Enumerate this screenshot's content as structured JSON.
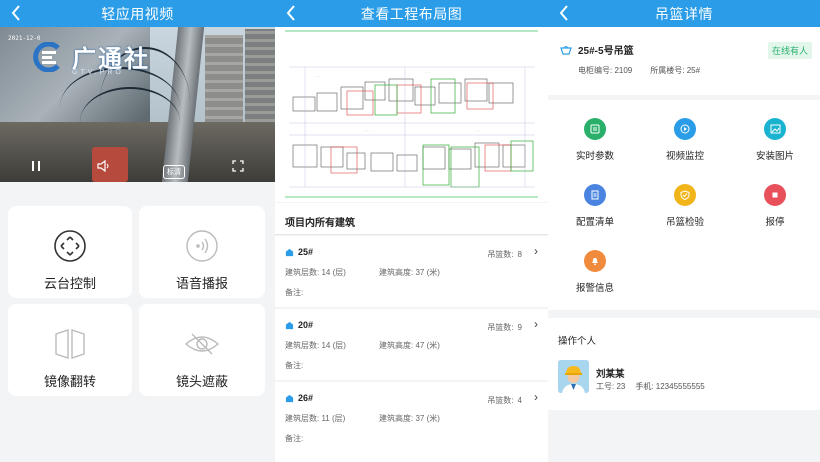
{
  "panel1": {
    "nav_title": "轻应用视频",
    "video": {
      "timestamp": "2021-12-0",
      "watermark_text": "广通社",
      "watermark_sub": "GTV.PRO",
      "quality": "标清"
    },
    "cards": [
      {
        "label": "云台控制",
        "icon": "ptz-icon"
      },
      {
        "label": "语音播报",
        "icon": "broadcast-icon"
      },
      {
        "label": "镜像翻转",
        "icon": "mirror-icon"
      },
      {
        "label": "镜头遮蔽",
        "icon": "eye-off-icon"
      }
    ]
  },
  "panel2": {
    "nav_title": "查看工程布局图",
    "section_title": "项目内所有建筑",
    "buildings": [
      {
        "name": "25#",
        "basket_label": "吊篮数:",
        "basket_count": "8",
        "floors": "建筑层数: 14 (层)",
        "height": "建筑高度: 37 (米)",
        "note": "备注:"
      },
      {
        "name": "20#",
        "basket_label": "吊篮数:",
        "basket_count": "9",
        "floors": "建筑层数: 14 (层)",
        "height": "建筑高度: 47 (米)",
        "note": "备注:"
      },
      {
        "name": "26#",
        "basket_label": "吊篮数:",
        "basket_count": "4",
        "floors": "建筑层数: 11 (层)",
        "height": "建筑高度: 37 (米)",
        "note": "备注:"
      }
    ]
  },
  "panel3": {
    "nav_title": "吊篮详情",
    "basket_name": "25#-5号吊篮",
    "status": "在线有人",
    "cabinet_no": "电柜编号: 2109",
    "building_no": "所属楼号: 25#",
    "functions": [
      {
        "label": "实时参数",
        "color": "#2bb06c",
        "icon": "parameters-icon"
      },
      {
        "label": "视频监控",
        "color": "#2b9de8",
        "icon": "video-icon"
      },
      {
        "label": "安装图片",
        "color": "#19b3cf",
        "icon": "image-icon"
      },
      {
        "label": "配置清单",
        "color": "#4a84e0",
        "icon": "list-icon"
      },
      {
        "label": "吊篮检验",
        "color": "#f1b419",
        "icon": "shield-check-icon"
      },
      {
        "label": "报停",
        "color": "#e8505b",
        "icon": "stop-icon"
      },
      {
        "label": "报警信息",
        "color": "#f08a3c",
        "icon": "bell-icon"
      }
    ],
    "operator_section": "操作个人",
    "operator_name": "刘某某",
    "operator_id": "工号: 23",
    "operator_phone": "手机: 12345555555"
  }
}
